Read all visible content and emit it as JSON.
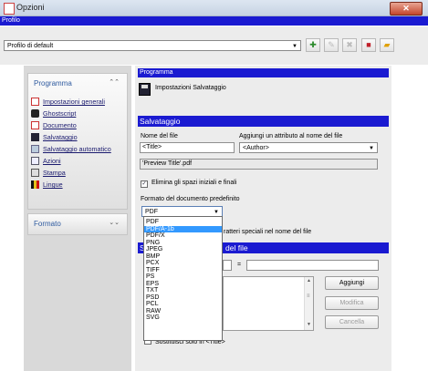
{
  "window": {
    "title": "Opzioni",
    "close_label": "✕"
  },
  "profile": {
    "section_label": "Profilo",
    "selected": "Profilo di default",
    "toolbar_icons": [
      "add-profile-icon",
      "rename-profile-icon",
      "delete-profile-icon",
      "save-profile-icon",
      "open-profile-icon"
    ]
  },
  "sidebar": {
    "program_header": "Programma",
    "format_header": "Formato",
    "items": [
      {
        "label": "Impostazioni generali",
        "icon": "settings-icon"
      },
      {
        "label": "Ghostscript",
        "icon": "ghostscript-icon"
      },
      {
        "label": "Documento",
        "icon": "document-icon"
      },
      {
        "label": "Salvataggio",
        "icon": "save-icon"
      },
      {
        "label": "Salvataggio automatico",
        "icon": "autosave-icon"
      },
      {
        "label": "Azioni",
        "icon": "actions-icon"
      },
      {
        "label": "Stampa",
        "icon": "print-icon"
      },
      {
        "label": "Lingue",
        "icon": "languages-icon"
      }
    ]
  },
  "panel": {
    "program_bar": "Programma",
    "page_title": "Impostazioni Salvataggio",
    "save_bar": "Salvataggio",
    "filename_label": "Nome del file",
    "attr_label": "Aggiungi un attributo al nome del file",
    "filename_value": "<Title>",
    "attr_selected": "<Author>",
    "preview_value": "'Preview Title'.pdf",
    "trim_spaces_label": "Elimina gli spazi iniziali e finali",
    "trim_spaces_checked": true,
    "default_format_label": "Formato del documento predefinito",
    "default_format_selected": "PDF",
    "special_chars_label": "ratteri speciali nel nome del file",
    "replace_bar_prefix": "S",
    "replace_bar_suffix": "del file",
    "equals": "=",
    "add_button": "Aggiungi",
    "modify_button": "Modifica",
    "delete_button": "Cancella",
    "bottom_note": "Sostituisci solo in <Title>"
  },
  "format_options": [
    "PDF",
    "PDF/A-1b",
    "PDF/X",
    "PNG",
    "JPEG",
    "BMP",
    "PCX",
    "TIFF",
    "PS",
    "EPS",
    "TXT",
    "PSD",
    "PCL",
    "RAW",
    "SVG"
  ],
  "format_highlighted_index": 1,
  "colors": {
    "bar_blue": "#1a1ad1",
    "link_blue": "#1a1a6e",
    "header_blue": "#2e5a9f",
    "highlight": "#3399ff"
  }
}
